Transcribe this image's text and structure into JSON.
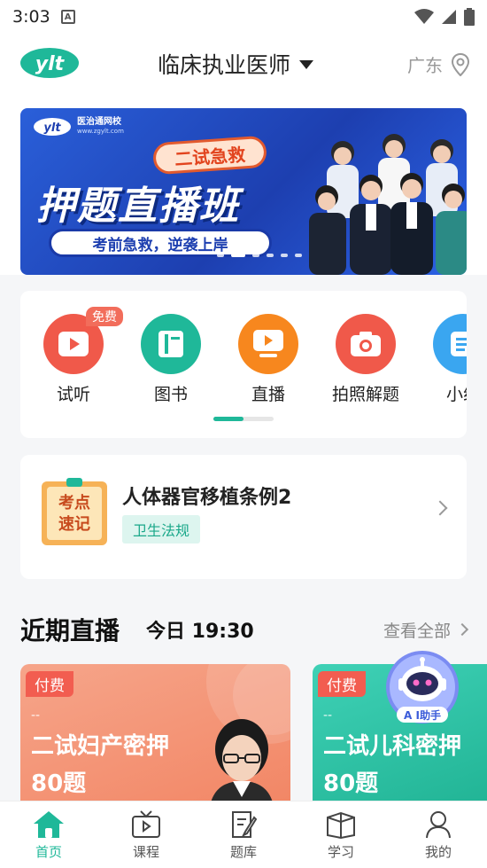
{
  "status_bar": {
    "time": "3:03",
    "notif_icon": "A"
  },
  "header": {
    "logo_text": "ylt",
    "title": "临床执业医师",
    "location": "广东"
  },
  "banner": {
    "brand": "医治通网校",
    "brand_url": "www.zgylt.com",
    "tag": "二试急救",
    "title": "押题直播班",
    "slogan": "考前急救，逆袭上岸",
    "page_count": 6,
    "active_index": 1
  },
  "features": [
    {
      "label": "试听",
      "icon": "play-icon",
      "color": "#f0594a",
      "badge": "免费"
    },
    {
      "label": "图书",
      "icon": "book-icon",
      "color": "#1fb899"
    },
    {
      "label": "直播",
      "icon": "live-tv-icon",
      "color": "#f7871e"
    },
    {
      "label": "拍照解题",
      "icon": "camera-icon",
      "color": "#f0594a"
    },
    {
      "label": "小组",
      "icon": "group-icon",
      "color": "#3aa6f0"
    }
  ],
  "note_card": {
    "icon_text_1": "考点",
    "icon_text_2": "速记",
    "title": "人体器官移植条例2",
    "tag": "卫生法规"
  },
  "live_section": {
    "title": "近期直播",
    "time": "今日 19:30",
    "view_all": "查看全部"
  },
  "live_cards": [
    {
      "badge": "付费",
      "dash": "--",
      "title": "二试妇产密押80题"
    },
    {
      "badge": "付费",
      "dash": "--",
      "title": "二试儿科密押80题"
    }
  ],
  "ai_helper": {
    "label": "A I助手"
  },
  "bottom_nav": [
    {
      "label": "首页",
      "icon": "home-icon",
      "active": true
    },
    {
      "label": "课程",
      "icon": "tv-icon",
      "active": false
    },
    {
      "label": "题库",
      "icon": "question-bank-icon",
      "active": false
    },
    {
      "label": "学习",
      "icon": "study-icon",
      "active": false
    },
    {
      "label": "我的",
      "icon": "profile-icon",
      "active": false
    }
  ],
  "colors": {
    "brand": "#1fb899",
    "accent_red": "#f25d50"
  }
}
